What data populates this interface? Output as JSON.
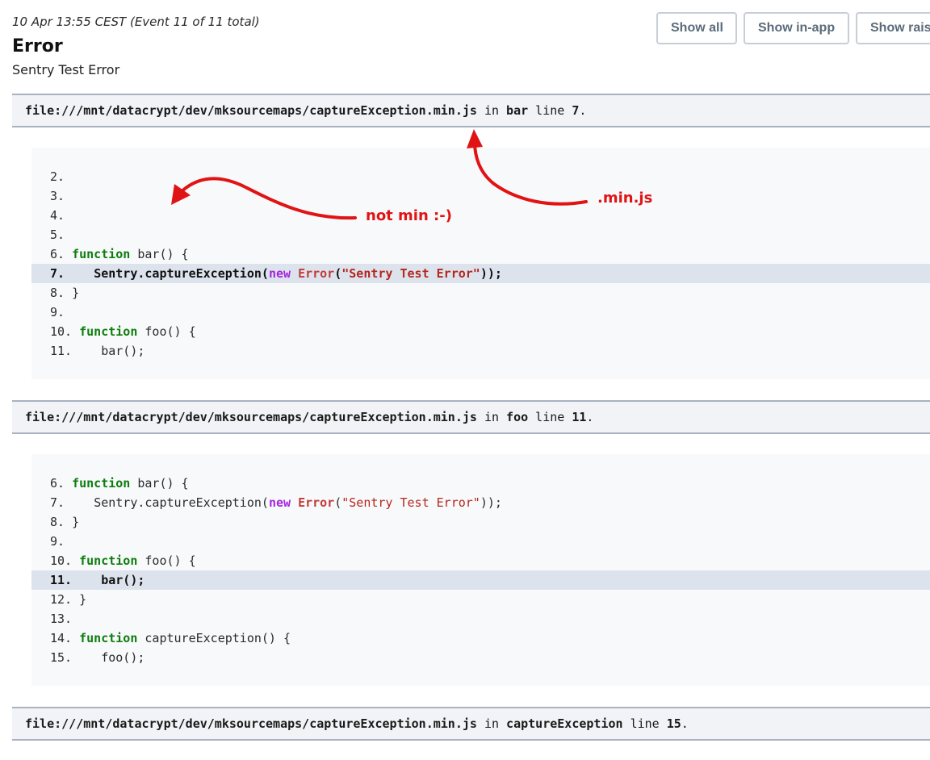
{
  "event": {
    "meta": "10 Apr 13:55 CEST (Event 11 of 11 total)",
    "title": "Error",
    "message": "Sentry Test Error"
  },
  "buttons": {
    "show_all": "Show all",
    "show_in_app": "Show in-app",
    "show_raw": "Show rais"
  },
  "frames": [
    {
      "file": "file:///mnt/datacrypt/dev/mksourcemaps/captureException.min.js",
      "in_word": "in",
      "function": "bar",
      "line_word": "line",
      "line": "7",
      "period": ".",
      "code": [
        {
          "num": "2.",
          "text": ""
        },
        {
          "num": "3.",
          "text": ""
        },
        {
          "num": "4.",
          "text": ""
        },
        {
          "num": "5.",
          "text": ""
        },
        {
          "num": "6.",
          "kw": "function",
          "rest": " bar() {"
        },
        {
          "num": "7.",
          "indent": "    ",
          "pre": "Sentry.captureException(",
          "kw_new": "new",
          "sp": " ",
          "cls": "Error",
          "paren": "(",
          "str": "\"Sentry Test Error\"",
          "post": "));"
        },
        {
          "num": "8.",
          "text": " }"
        },
        {
          "num": "9.",
          "text": ""
        },
        {
          "num": "10.",
          "kw": "function",
          "rest": " foo() {"
        },
        {
          "num": "11.",
          "text": "    bar();"
        }
      ]
    },
    {
      "file": "file:///mnt/datacrypt/dev/mksourcemaps/captureException.min.js",
      "in_word": "in",
      "function": "foo",
      "line_word": "line",
      "line": "11",
      "period": ".",
      "code": [
        {
          "num": "6.",
          "kw": "function",
          "rest": " bar() {"
        },
        {
          "num": "7.",
          "indent": "    ",
          "pre": "Sentry.captureException(",
          "kw_new": "new",
          "sp": " ",
          "cls": "Error",
          "paren": "(",
          "str": "\"Sentry Test Error\"",
          "post": "));"
        },
        {
          "num": "8.",
          "text": " }"
        },
        {
          "num": "9.",
          "text": ""
        },
        {
          "num": "10.",
          "kw": "function",
          "rest": " foo() {"
        },
        {
          "num": "11.",
          "text": "    bar();"
        },
        {
          "num": "12.",
          "text": " }"
        },
        {
          "num": "13.",
          "text": ""
        },
        {
          "num": "14.",
          "kw": "function",
          "rest": " captureException() {"
        },
        {
          "num": "15.",
          "text": "    foo();"
        }
      ]
    },
    {
      "file": "file:///mnt/datacrypt/dev/mksourcemaps/captureException.min.js",
      "in_word": "in",
      "function": "captureException",
      "line_word": "line",
      "line": "15",
      "period": "."
    }
  ],
  "annotations": {
    "not_min": "not min :-)",
    "min_js": ".min.js",
    "color": "#e01414"
  },
  "colors": {
    "keyword": "#0d7d0d",
    "new_keyword": "#a526e0",
    "error_class": "#c23b3b",
    "string": "#b5261e",
    "highlight_row": "#dde3ec",
    "frame_header_bg": "#f1f3f6",
    "code_bg": "#f8f9fb"
  }
}
